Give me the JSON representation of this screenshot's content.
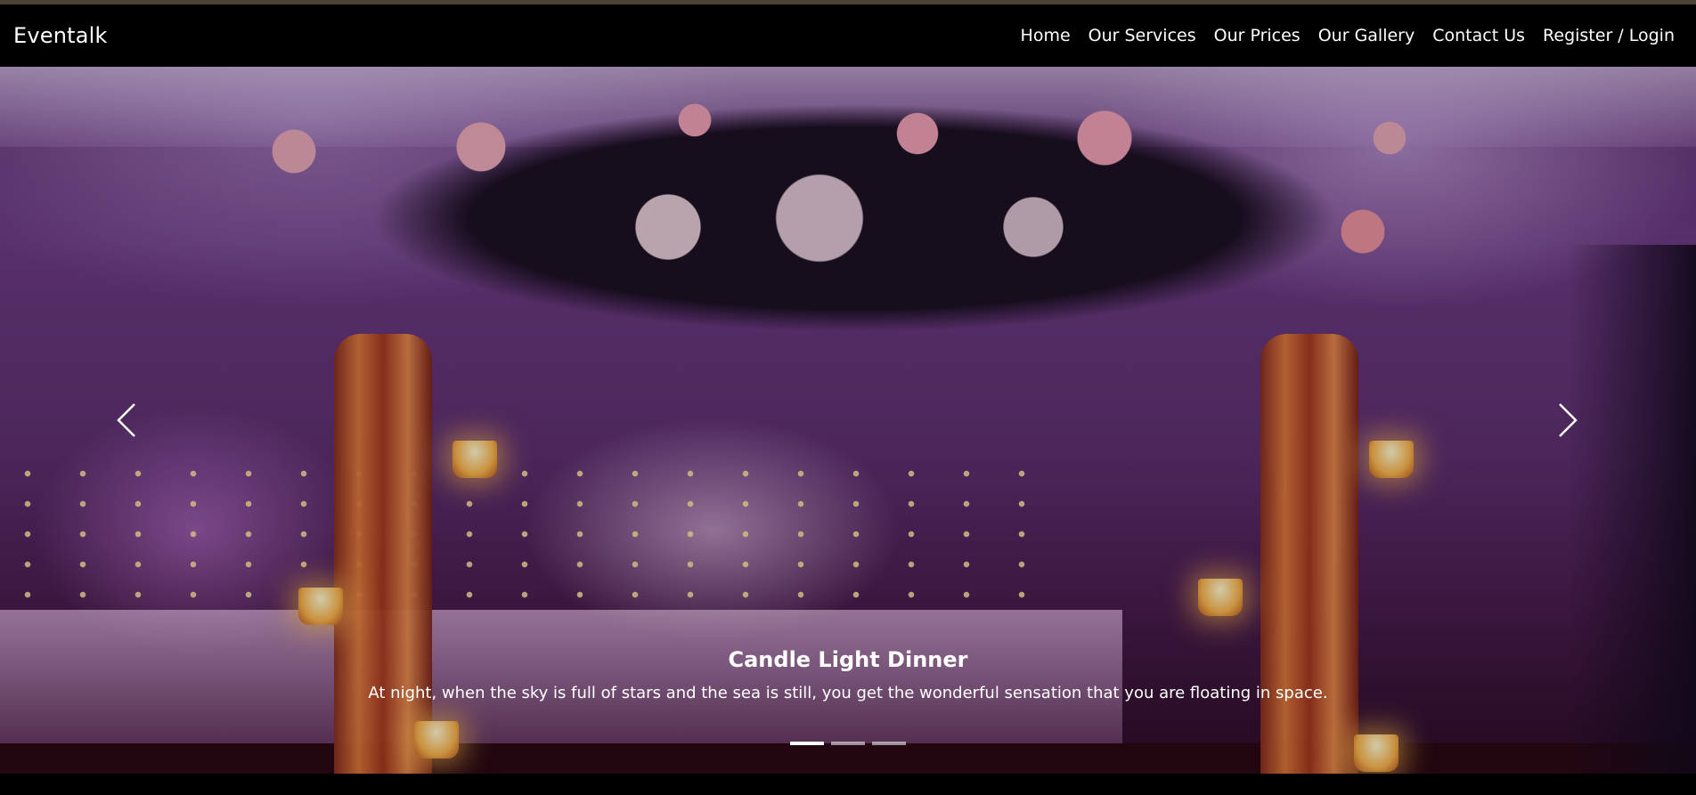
{
  "navbar": {
    "brand": "Eventalk",
    "links": [
      {
        "label": "Home"
      },
      {
        "label": "Our Services"
      },
      {
        "label": "Our Prices"
      },
      {
        "label": "Our Gallery"
      },
      {
        "label": "Contact Us"
      },
      {
        "label": "Register / Login"
      }
    ]
  },
  "carousel": {
    "slide": {
      "title": "Candle Light Dinner",
      "text": "At night, when the sky is full of stars and the sea is still, you get the wonderful sensation that you are floating in space.",
      "image_subject": "floral arch with candles in a purple-lit banquet hall"
    },
    "prev_icon": "chevron-left-icon",
    "next_icon": "chevron-right-icon",
    "indicators": {
      "count": 3,
      "active_index": 0
    }
  },
  "colors": {
    "navbar_bg": "#000000",
    "text": "#ffffff",
    "top_strip": "#4a4331"
  }
}
